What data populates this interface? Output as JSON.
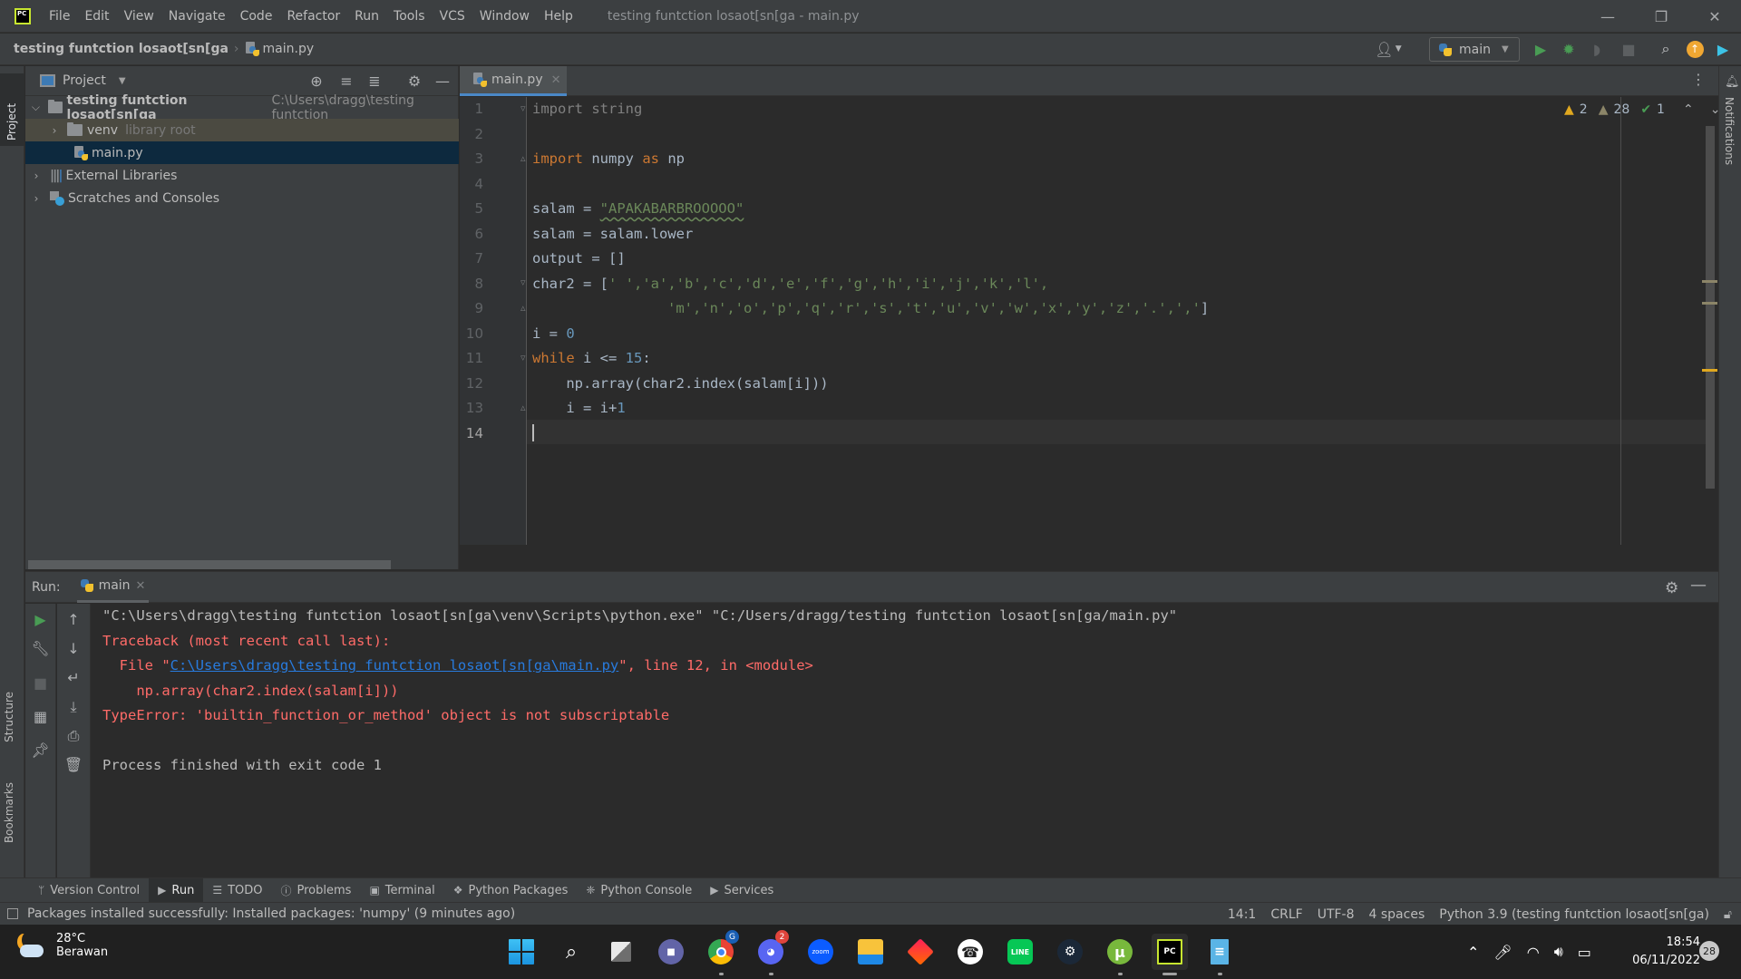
{
  "menubar": {
    "items": [
      "File",
      "Edit",
      "View",
      "Navigate",
      "Code",
      "Refactor",
      "Run",
      "Tools",
      "VCS",
      "Window",
      "Help"
    ],
    "window_title": "testing funtction losaot[sn[ga - main.py",
    "logo": "PC"
  },
  "navbar": {
    "project": "testing funtction losaot[sn[ga",
    "file": "main.py",
    "run_config": "main"
  },
  "left_stripe": {
    "project": "Project",
    "structure": "Structure",
    "bookmarks": "Bookmarks"
  },
  "right_stripe": {
    "notifications": "Notifications"
  },
  "project_panel": {
    "title": "Project",
    "tree": [
      {
        "label": "testing funtction losaot[sn[ga",
        "hint": "C:\\Users\\dragg\\testing funtction",
        "expanded": true
      },
      {
        "label": "venv",
        "hint": "library root",
        "expanded": false
      },
      {
        "label": "main.py",
        "hint": ""
      },
      {
        "label": "External Libraries",
        "hint": ""
      },
      {
        "label": "Scratches and Consoles",
        "hint": ""
      }
    ]
  },
  "editor": {
    "tab": "main.py",
    "inspections": {
      "warnings": "2",
      "weak_warnings": "28",
      "typos": "1"
    },
    "line_numbers": [
      "1",
      "2",
      "3",
      "4",
      "5",
      "6",
      "7",
      "8",
      "9",
      "10",
      "11",
      "12",
      "13",
      "14"
    ],
    "code": {
      "l1_kw": "import",
      "l1_rest": " string",
      "l3_kw": "import",
      "l3_a": " numpy ",
      "l3_as": "as",
      "l3_b": " np",
      "l5_a": "salam = ",
      "l5_str": "\"APAKABARBROOOOO\"",
      "l6": "salam = salam.lower",
      "l7": "output = []",
      "l8_a": "char2 = [",
      "l8_str": "' ','a','b','c','d','e','f','g','h','i','j','k','l',",
      "l9_str": "'m','n','o','p','q','r','s','t','u','v','w','x','y','z','.',','",
      "l9_end": "]",
      "l10_a": "i = ",
      "l10_num": "0",
      "l11_kw": "while",
      "l11_a": " i <= ",
      "l11_num": "15",
      "l11_b": ":",
      "l12": "    np.array(char2.index(salam[i]))",
      "l13_a": "    i = i+",
      "l13_num": "1"
    }
  },
  "run_panel": {
    "label": "Run:",
    "tab": "main",
    "console": [
      "\"C:\\Users\\dragg\\testing funtction losaot[sn[ga\\venv\\Scripts\\python.exe\" \"C:/Users/dragg/testing funtction losaot[sn[ga/main.py\"",
      "Traceback (most recent call last):",
      "  File \"",
      "C:\\Users\\dragg\\testing funtction losaot[sn[ga\\main.py",
      "\", line 12, in <module>",
      "    np.array(char2.index(salam[i]))",
      "TypeError: 'builtin_function_or_method' object is not subscriptable",
      "Process finished with exit code 1"
    ]
  },
  "bottom_tools": [
    "Version Control",
    "Run",
    "TODO",
    "Problems",
    "Terminal",
    "Python Packages",
    "Python Console",
    "Services"
  ],
  "status_bar": {
    "message": "Packages installed successfully: Installed packages: 'numpy' (9 minutes ago)",
    "position": "14:1",
    "line_sep": "CRLF",
    "encoding": "UTF-8",
    "indent": "4 spaces",
    "interpreter": "Python 3.9 (testing funtction losaot[sn[ga)"
  },
  "taskbar": {
    "weather_temp": "28°C",
    "weather_desc": "Berawan",
    "discord_badge": "2",
    "chrome_badge": "G",
    "time": "18:54",
    "date": "06/11/2022",
    "notifications": "28"
  },
  "colors": {
    "keyword": "#cc7832",
    "string": "#6a8759",
    "number": "#6897bb",
    "error": "#ff6b68",
    "link": "#287bde",
    "accent": "#4a88c7"
  }
}
